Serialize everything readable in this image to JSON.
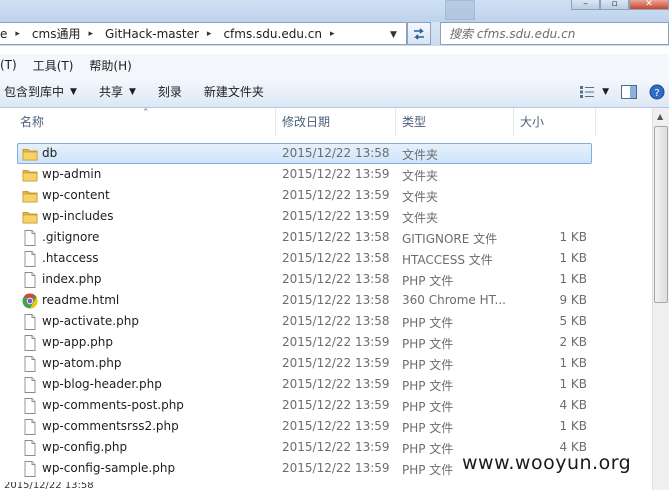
{
  "address": {
    "crumbs": [
      "e",
      "cms通用",
      "GitHack-master",
      "cfms.sdu.edu.cn"
    ],
    "search_placeholder": "搜索 cfms.sdu.edu.cn"
  },
  "menu": [
    "(T)",
    "工具(T)",
    "帮助(H)"
  ],
  "commands": {
    "include_library": "包含到库中",
    "share": "共享",
    "burn": "刻录",
    "new_folder": "新建文件夹"
  },
  "columns": {
    "name": "名称",
    "date": "修改日期",
    "type": "类型",
    "size": "大小"
  },
  "files": [
    {
      "name": "db",
      "date": "2015/12/22 13:58",
      "type": "文件夹",
      "size": "",
      "icon": "folder",
      "selected": true
    },
    {
      "name": "wp-admin",
      "date": "2015/12/22 13:59",
      "type": "文件夹",
      "size": "",
      "icon": "folder"
    },
    {
      "name": "wp-content",
      "date": "2015/12/22 13:59",
      "type": "文件夹",
      "size": "",
      "icon": "folder"
    },
    {
      "name": "wp-includes",
      "date": "2015/12/22 13:59",
      "type": "文件夹",
      "size": "",
      "icon": "folder"
    },
    {
      "name": ".gitignore",
      "date": "2015/12/22 13:58",
      "type": "GITIGNORE 文件",
      "size": "1 KB",
      "icon": "file"
    },
    {
      "name": ".htaccess",
      "date": "2015/12/22 13:58",
      "type": "HTACCESS 文件",
      "size": "1 KB",
      "icon": "file"
    },
    {
      "name": "index.php",
      "date": "2015/12/22 13:58",
      "type": "PHP 文件",
      "size": "1 KB",
      "icon": "file"
    },
    {
      "name": "readme.html",
      "date": "2015/12/22 13:58",
      "type": "360 Chrome HT...",
      "size": "9 KB",
      "icon": "chrome"
    },
    {
      "name": "wp-activate.php",
      "date": "2015/12/22 13:58",
      "type": "PHP 文件",
      "size": "5 KB",
      "icon": "file"
    },
    {
      "name": "wp-app.php",
      "date": "2015/12/22 13:59",
      "type": "PHP 文件",
      "size": "2 KB",
      "icon": "file"
    },
    {
      "name": "wp-atom.php",
      "date": "2015/12/22 13:59",
      "type": "PHP 文件",
      "size": "1 KB",
      "icon": "file"
    },
    {
      "name": "wp-blog-header.php",
      "date": "2015/12/22 13:59",
      "type": "PHP 文件",
      "size": "1 KB",
      "icon": "file"
    },
    {
      "name": "wp-comments-post.php",
      "date": "2015/12/22 13:59",
      "type": "PHP 文件",
      "size": "4 KB",
      "icon": "file"
    },
    {
      "name": "wp-commentsrss2.php",
      "date": "2015/12/22 13:59",
      "type": "PHP 文件",
      "size": "1 KB",
      "icon": "file"
    },
    {
      "name": "wp-config.php",
      "date": "2015/12/22 13:59",
      "type": "PHP 文件",
      "size": "4 KB",
      "icon": "file"
    },
    {
      "name": "wp-config-sample.php",
      "date": "2015/12/22 13:59",
      "type": "PHP 文件",
      "size": "",
      "icon": "file"
    }
  ],
  "watermark": "www.wooyun.org",
  "status_text": "2015/12/22 13:58"
}
